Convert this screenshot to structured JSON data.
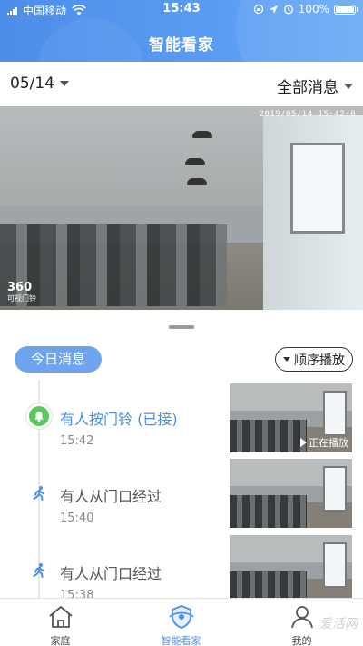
{
  "status_bar": {
    "carrier": "中国移动",
    "time": "15:43",
    "battery": "100%",
    "battery_level": 1.0
  },
  "header": {
    "title": "智能看家"
  },
  "filter": {
    "date": "05/14",
    "message_type": "全部消息"
  },
  "video": {
    "timestamp": "2019/05/14 15:42:0",
    "logo_main": "360",
    "logo_sub": "可视门铃"
  },
  "messages": {
    "section_label": "今日消息",
    "sequence_play": "顺序播放",
    "items": [
      {
        "label": "有人按门铃 (已接)",
        "time": "15:42",
        "icon": "bell-icon",
        "color": "#5cc760",
        "label_color": "#4c8ee8",
        "thumb_status": "正在播放"
      },
      {
        "label": "有人从门口经过",
        "time": "15:40",
        "icon": "walking-person-icon",
        "color": "#4c8ee8",
        "label_color": "#555555"
      },
      {
        "label": "有人从门口经过",
        "time": "15:38",
        "icon": "walking-person-icon",
        "color": "#4c8ee8",
        "label_color": "#555555"
      }
    ]
  },
  "tabbar": {
    "tabs": [
      {
        "label": "家庭",
        "icon": "home-icon",
        "active": false
      },
      {
        "label": "智能看家",
        "icon": "shield-icon",
        "active": true
      },
      {
        "label": "我的",
        "icon": "profile-icon",
        "active": false
      }
    ]
  },
  "watermark": "爱活网",
  "colors": {
    "accent": "#4c8ee8",
    "pill": "#6ea4ef",
    "success": "#5cc760"
  }
}
